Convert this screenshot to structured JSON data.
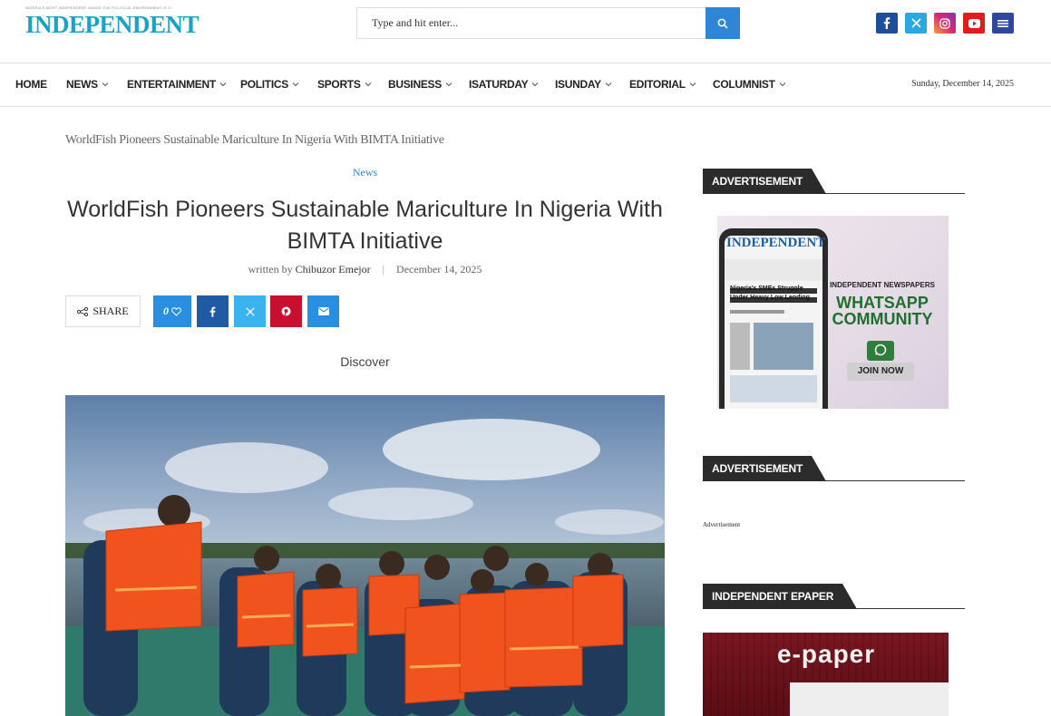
{
  "header": {
    "logo_tagline": "NIGERIA'S MOST INDEPENDENT GANGE THE POLITICAL ENVIRONMENT IS 1!",
    "logo_text": "INDEPENDENT",
    "search_placeholder": "Type and hit enter...",
    "social_icons": [
      "facebook-icon",
      "x-icon",
      "instagram-icon",
      "youtube-icon",
      "menu-icon"
    ]
  },
  "nav": {
    "items": [
      "HOME",
      "NEWS",
      "ENTERTAINMENT",
      "POLITICS",
      "SPORTS",
      "BUSINESS",
      "ISATURDAY",
      "ISUNDAY",
      "EDITORIAL",
      "COLUMNIST"
    ],
    "date": "Sunday, December 14, 2025"
  },
  "article": {
    "breadcrumb": "WorldFish Pioneers Sustainable Mariculture In Nigeria With BIMTA Initiative",
    "category": "News",
    "title": "WorldFish Pioneers Sustainable Mariculture In Nigeria With BIMTA Initiative",
    "written_by": "written by",
    "author": "Chibuzor Emejor",
    "date": "December 14, 2025",
    "share_label": "SHARE",
    "like_count": "0",
    "discover": "Discover"
  },
  "sidebar": {
    "widget1_title": "ADVERTISEMENT",
    "widget2_title": "ADVERTISEMENT",
    "widget2_text": "Advertisement",
    "widget3_title": "INDEPENDENT EPAPER",
    "ad": {
      "paper_name": "INDEPENDENT",
      "paper_headline": "Nigeria's SMEs Struggle Under Heavy Low Lending",
      "line1": "INDEPENDENT NEWSPAPERS",
      "line2": "WHATSAPP",
      "line3": "COMMUNITY",
      "cta": "JOIN NOW"
    },
    "epaper_text": "e-paper"
  },
  "colors": {
    "brand": "#1aa3c8",
    "accent_blue": "#2f86d6",
    "widget_dark": "#2b2b2b"
  }
}
